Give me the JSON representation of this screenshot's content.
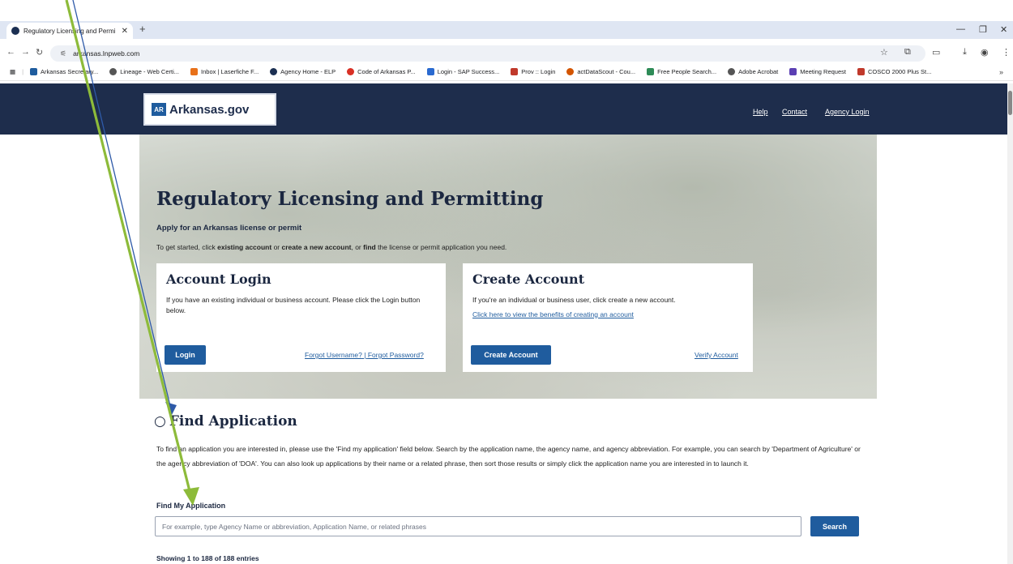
{
  "browser": {
    "tab_title": "Regulatory Licensing and Permi",
    "url": "arkansas.lnpweb.com",
    "bookmarks": [
      {
        "label": "Arkansas Secretary...",
        "color": "#1f5c9e"
      },
      {
        "label": "Lineage - Web Certi...",
        "color": "#555555"
      },
      {
        "label": "Inbox | Laserfiche F...",
        "color": "#e8711a"
      },
      {
        "label": "Agency Home - ELP",
        "color": "#1b2f52"
      },
      {
        "label": "Code of Arkansas P...",
        "color": "#d93025"
      },
      {
        "label": "Login - SAP Success...",
        "color": "#2a6ad0"
      },
      {
        "label": "Prov :: Login",
        "color": "#c0392b"
      },
      {
        "label": "actDataScout - Cou...",
        "color": "#d35400"
      },
      {
        "label": "Free People Search...",
        "color": "#2e8b57"
      },
      {
        "label": "Adobe Acrobat",
        "color": "#555555"
      },
      {
        "label": "Meeting Request",
        "color": "#5b3fb3"
      },
      {
        "label": "COSCO 2000 Plus St...",
        "color": "#c0392b"
      }
    ]
  },
  "header": {
    "logo_mark": "AR",
    "logo_text": "Arkansas.gov",
    "links": {
      "help": "Help",
      "contact": "Contact",
      "agency_login": "Agency Login"
    }
  },
  "hero": {
    "title": "Regulatory Licensing and Permitting",
    "subtitle": "Apply for an Arkansas license or permit",
    "help_1": "To get started, click ",
    "help_b1": "existing account",
    "help_2": " or ",
    "help_b2": "create a new account",
    "help_3": ", or ",
    "help_b3": "find",
    "help_4": " the license or permit application you need."
  },
  "login_card": {
    "title": "Account Login",
    "text": "If you have an existing individual or business account. Please click the Login button below.",
    "button": "Login",
    "forgot_username": "Forgot Username?",
    "separator": "|",
    "forgot_password": "Forgot Password?"
  },
  "create_card": {
    "title": "Create Account",
    "text": "If you're an individual or business user, click create a new account.",
    "benefits_link": "Click here to view the benefits of creating an account",
    "button": "Create Account",
    "verify": "Verify Account"
  },
  "find": {
    "title": "Find Application",
    "description": "To find an application you are interested in, please use the 'Find my application' field below. Search by the application name, the agency name, and agency abbreviation. For example, you can search by 'Department of Agriculture' or the agency abbreviation of 'DOA'. You can also look up applications by their name or a related phrase, then sort those results or simply click the application name you are interested in to launch it.",
    "label": "Find My Application",
    "placeholder": "For example, type Agency Name or abbreviation, Application Name, or related phrases",
    "search_button": "Search",
    "entries": "Showing 1 to 188 of 188 entries"
  }
}
